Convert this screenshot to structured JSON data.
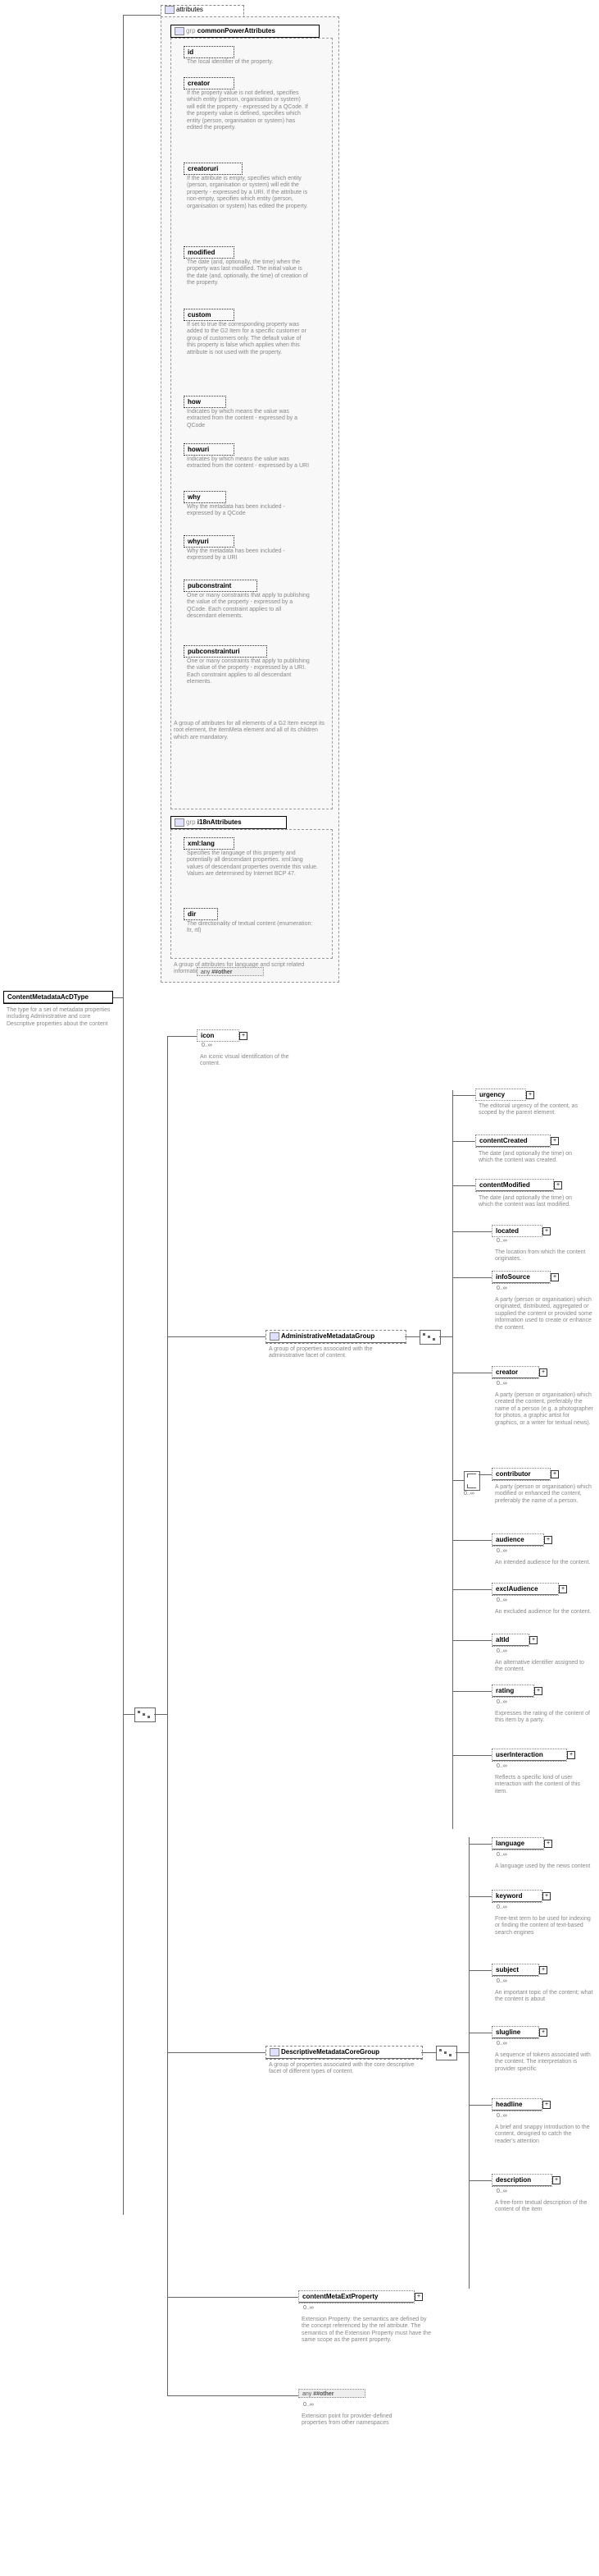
{
  "root": {
    "title": "ContentMetadataAcDType",
    "desc": "The type for a  set of metadata properties including Administrative and core Descriptive properties about the content"
  },
  "attributes_label": "attributes",
  "commonPower": {
    "label": "commonPowerAttributes",
    "grp": "grp",
    "desc": "A group of attributes for all elements of a G2 Item except its root element, the itemMeta element and all of its children which are mandatory.",
    "items": [
      {
        "name": "id",
        "desc": "The local identifier of the property."
      },
      {
        "name": "creator",
        "desc": "If the property value is not defined, specifies which entity (person, organisation or system) will edit the property - expressed by a QCode. If the property value is defined, specifies which entity (person, organisation or system) has edited the property."
      },
      {
        "name": "creatoruri",
        "desc": "If the attribute is empty, specifies which entity (person, organisation or system) will edit the property - expressed by a URI. If the attribute is non-empty, specifies which entity (person, organisation or system) has edited the property."
      },
      {
        "name": "modified",
        "desc": "The date (and, optionally, the time) when the property was last modified. The initial value is the date (and, optionally, the time) of creation of the property."
      },
      {
        "name": "custom",
        "desc": "If set to true the corresponding property was added to the G2 Item for a specific customer or group of customers only. The default value of this property is false which applies when this attribute is not used with the property."
      },
      {
        "name": "how",
        "desc": "Indicates by which means the value was extracted from the content - expressed by a QCode"
      },
      {
        "name": "howuri",
        "desc": "Indicates by which means the value was extracted from the content - expressed by a URI"
      },
      {
        "name": "why",
        "desc": "Why the metadata has been included - expressed by a QCode"
      },
      {
        "name": "whyuri",
        "desc": "Why the metadata has been included - expressed by a URI"
      },
      {
        "name": "pubconstraint",
        "desc": "One or many constraints that apply to publishing the value of the property - expressed by a QCode. Each constraint applies to all descendant elements."
      },
      {
        "name": "pubconstrainturi",
        "desc": "One or many constraints that apply to publishing the value of the property - expressed by a URI. Each constraint applies to all descendant elements."
      }
    ]
  },
  "i18n": {
    "label": "i18nAttributes",
    "grp": "grp",
    "desc": "A group of attributes for language and script related information",
    "items": [
      {
        "name": "xml:lang",
        "desc": "Specifies the language of this property and potentially all descendant properties. xml:lang values of descendant properties override this value. Values are determined by Internet BCP 47."
      },
      {
        "name": "dir",
        "desc": "The directionality of textual content (enumeration: ltr, rtl)"
      }
    ],
    "any": "##other"
  },
  "icon": {
    "name": "icon",
    "card": "0..∞",
    "desc": "An iconic visual identification of the content."
  },
  "adminGroup": {
    "label": "AdministrativeMetadataGroup",
    "desc": "A group of properties associated with the administrative facet of content.",
    "items": [
      {
        "name": "urgency",
        "desc": "The editorial urgency of the content, as scoped by the parent element."
      },
      {
        "name": "contentCreated",
        "desc": "The date (and optionally the time) on which the content was created."
      },
      {
        "name": "contentModified",
        "desc": "The date (and optionally the time) on which the content was last modified."
      },
      {
        "name": "located",
        "card": "0..∞",
        "desc": "The location from which the content originates."
      },
      {
        "name": "infoSource",
        "card": "0..∞",
        "desc": "A party (person or organisation) which originated, distributed, aggregated or supplied the content or provided some information used to create or enhance the content."
      },
      {
        "name": "creator",
        "card": "0..∞",
        "desc": "A party (person or organisation) which created the content, preferably the name of a person (e.g. a photographer for photos, a graphic artist for graphics, or a writer for textual news)."
      },
      {
        "name": "contributor",
        "card": "0..∞",
        "desc": "A party (person or organisation) which modified or enhanced the content, preferably the name of a person."
      },
      {
        "name": "audience",
        "card": "0..∞",
        "desc": "An intended audience for the content."
      },
      {
        "name": "exclAudience",
        "card": "0..∞",
        "desc": "An excluded audience for the content."
      },
      {
        "name": "altId",
        "card": "0..∞",
        "desc": "An alternative identifier assigned to the content."
      },
      {
        "name": "rating",
        "card": "0..∞",
        "desc": "Expresses the rating of the content of this item by a party."
      },
      {
        "name": "userInteraction",
        "card": "0..∞",
        "desc": "Reflects a specific kind of user interaction with the content of this item."
      }
    ]
  },
  "descGroup": {
    "label": "DescriptiveMetadataCoreGroup",
    "desc": "A group of properties associated with the core descriptive facet of different types of content.",
    "items": [
      {
        "name": "language",
        "card": "0..∞",
        "desc": "A language used by the news content"
      },
      {
        "name": "keyword",
        "card": "0..∞",
        "desc": "Free-text term to be used for indexing or finding the content of text-based search engines"
      },
      {
        "name": "subject",
        "card": "0..∞",
        "desc": "An important topic of the content; what the content is about"
      },
      {
        "name": "slugline",
        "card": "0..∞",
        "desc": "A sequence of tokens associated with the content. The interpretation is provider specific"
      },
      {
        "name": "headline",
        "card": "0..∞",
        "desc": "A brief and snappy introduction to the content, designed to catch the reader's attention"
      },
      {
        "name": "description",
        "card": "0..∞",
        "desc": "A free-form textual description of the content of the item"
      }
    ]
  },
  "ext": {
    "name": "contentMetaExtProperty",
    "card": "0..∞",
    "desc": "Extension Property: the semantics are defined by the concept referenced by the rel attribute. The semantics of the Extension Property must have the same scope as the parent property."
  },
  "otherTail": {
    "any": "##other",
    "card": "0..∞",
    "desc": "Extension point for provider-defined properties from other namespaces"
  },
  "anyLabel": "any"
}
